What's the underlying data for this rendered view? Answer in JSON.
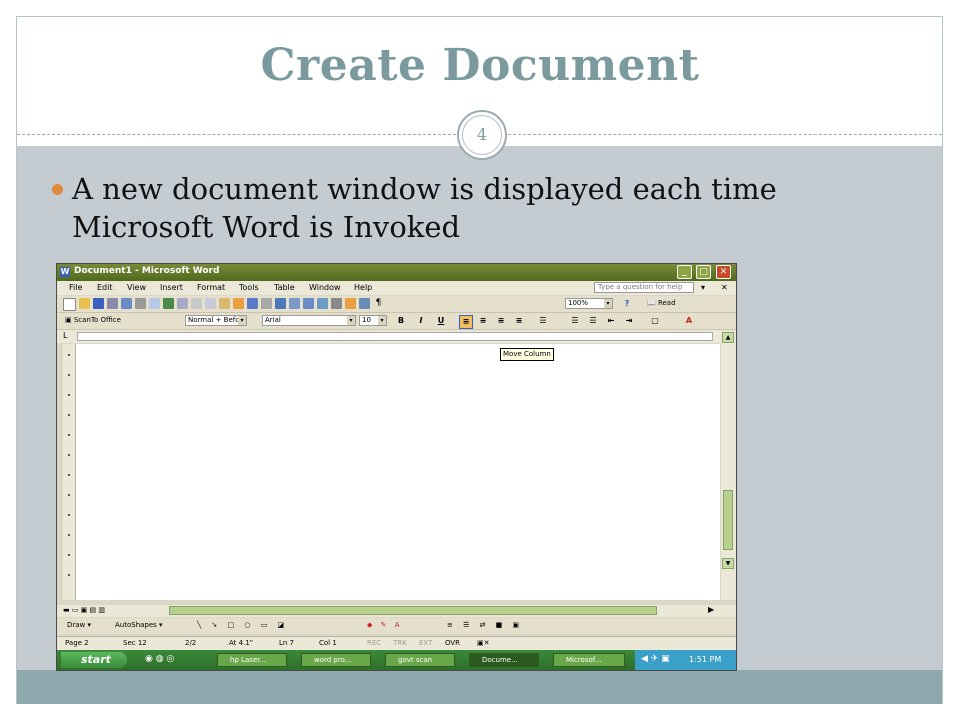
{
  "slide": {
    "title": "Create Document",
    "page_number": "4",
    "bullet": "A new document window is displayed each time Microsoft Word is Invoked"
  },
  "word": {
    "window_title": "Document1 - Microsoft Word",
    "menu": [
      "File",
      "Edit",
      "View",
      "Insert",
      "Format",
      "Tools",
      "Table",
      "Window",
      "Help"
    ],
    "help_placeholder": "Type a question for help",
    "zoom": "100%",
    "read_label": "Read",
    "scan_label": "ScanTo Office",
    "style_value": "Normal + Befor",
    "font_value": "Arial",
    "size_value": "10",
    "bold": "B",
    "italic": "I",
    "underline": "U",
    "tooltip": "Move Column",
    "draw_label": "Draw",
    "autoshapes_label": "AutoShapes",
    "status": {
      "page": "Page 2",
      "sec": "Sec 12",
      "pages": "2/2",
      "at": "At 4.1\"",
      "ln": "Ln 7",
      "col": "Col 1",
      "rec": "REC",
      "trk": "TRK",
      "ext": "EXT",
      "ovr": "OVR"
    },
    "taskbar": {
      "start": "start",
      "buttons": [
        "hp Laser...",
        "word pro...",
        "govt scan",
        "Docume...",
        "Microsof..."
      ],
      "clock": "1:51 PM"
    }
  }
}
